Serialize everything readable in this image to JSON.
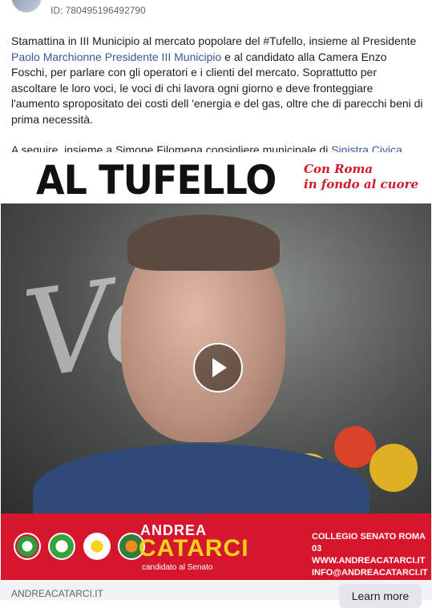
{
  "post": {
    "id_text": "ID: 780495196492790",
    "paragraph1_pre": "Stamattina in III Municipio al mercato popolare del #Tufello, insieme al Presidente ",
    "paragraph1_link": "Paolo Marchionne Presidente III Municipio",
    "paragraph1_post": " e al candidato alla Camera Enzo Foschi, per parlare con gli operatori e i clienti del mercato. Soprattutto per ascoltare le loro voci, le voci di chi lavora ogni giorno e deve fronteggiare l'aumento spropositato dei costi dell 'energia e del gas, oltre che di parecchi beni di prima necessità.",
    "paragraph2_pre": "A seguire, insieme a Simone Filomena consigliere municipale di ",
    "paragraph2_link": "Sinistra Civica",
    "paragraph2_ellipsis": "…"
  },
  "video": {
    "banner_title": "AL TUFELLO",
    "slogan_line1": "Con Roma",
    "slogan_line2": "in fondo al cuore",
    "play_icon": "play-icon",
    "candidate_first": "ANDREA",
    "candidate_last": "CATARCI",
    "candidate_role": "candidato al Senato",
    "contact_line1": "COLLEGIO SENATO ROMA 03",
    "contact_line2": "WWW.ANDREACATARCI.IT",
    "contact_line3": "INFO@ANDREACATARCI.IT",
    "party_logos": [
      "pd-logo",
      "europa-logo",
      "civica-logo",
      "verdi-logo"
    ]
  },
  "link_preview": {
    "domain": "ANDREACATARCI.IT",
    "cta_label": "Learn more"
  },
  "colors": {
    "link": "#385898",
    "banner_red": "#d6162d",
    "candidate_yellow": "#f6d31a"
  }
}
